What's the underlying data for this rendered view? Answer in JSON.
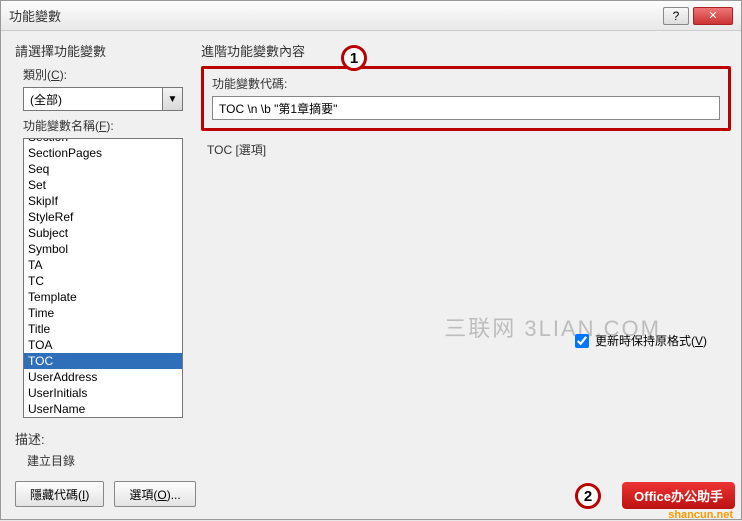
{
  "titlebar": {
    "title": "功能變數"
  },
  "left": {
    "heading": "請選擇功能變數",
    "category_label": "類別",
    "category_key": "C",
    "category_value": "(全部)",
    "names_label": "功能變數名稱",
    "names_key": "F",
    "items": [
      "Section",
      "SectionPages",
      "Seq",
      "Set",
      "SkipIf",
      "StyleRef",
      "Subject",
      "Symbol",
      "TA",
      "TC",
      "Template",
      "Time",
      "Title",
      "TOA",
      "TOC",
      "UserAddress",
      "UserInitials",
      "UserName"
    ],
    "selected_index": 14
  },
  "right": {
    "heading": "進階功能變數內容",
    "code_label": "功能變數代碼:",
    "code_value": "TOC \\n \\b \"第1章摘要\"",
    "options_label": "TOC [選項]",
    "preserve_label": "更新時保持原格式",
    "preserve_key": "V",
    "preserve_checked": true
  },
  "desc": {
    "label": "描述:",
    "text": "建立目錄"
  },
  "buttons": {
    "hide_codes": "隱藏代碼",
    "hide_codes_key": "I",
    "options": "選項",
    "options_key": "O"
  },
  "watermark": "三联网 3LIAN.COM",
  "callouts": {
    "n1": "1",
    "n2": "2"
  },
  "badge": "Office办公助手",
  "shancun": "shancun.net"
}
